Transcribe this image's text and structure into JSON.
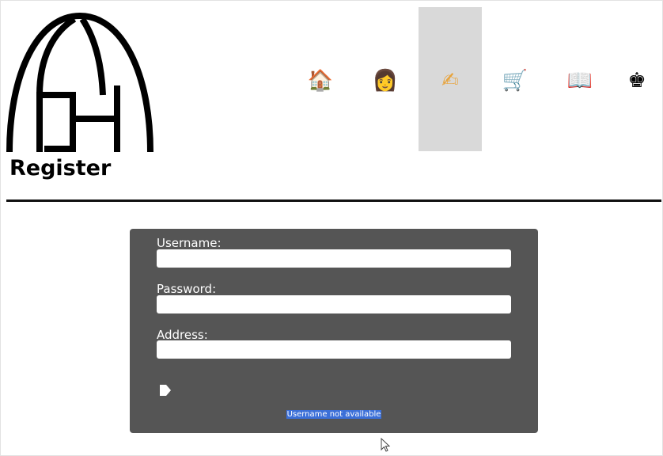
{
  "header": {
    "title": "Register",
    "logo_text": "GA"
  },
  "nav": {
    "items": [
      {
        "name": "home",
        "icon": "house-icon",
        "glyph": "🏠",
        "active": false
      },
      {
        "name": "account",
        "icon": "person-icon",
        "glyph": "👩",
        "active": false
      },
      {
        "name": "register",
        "icon": "writing-hand-icon",
        "glyph": "✍",
        "active": true
      },
      {
        "name": "cart",
        "icon": "shopping-cart-icon",
        "glyph": "🛒",
        "active": false
      },
      {
        "name": "catalog",
        "icon": "open-book-icon",
        "glyph": "📖",
        "active": false
      },
      {
        "name": "chess",
        "icon": "chess-king-icon",
        "glyph": "♚",
        "active": false
      }
    ]
  },
  "form": {
    "username_label": "Username:",
    "username_value": "",
    "password_label": "Password:",
    "password_value": "",
    "address_label": "Address:",
    "address_value": "",
    "submit_icon": "arrow-right-icon",
    "error_message": "Username not available"
  },
  "colors": {
    "panel_bg": "#555555",
    "active_nav_bg": "#d9d9d9",
    "selection_highlight": "#3b6fd8"
  }
}
